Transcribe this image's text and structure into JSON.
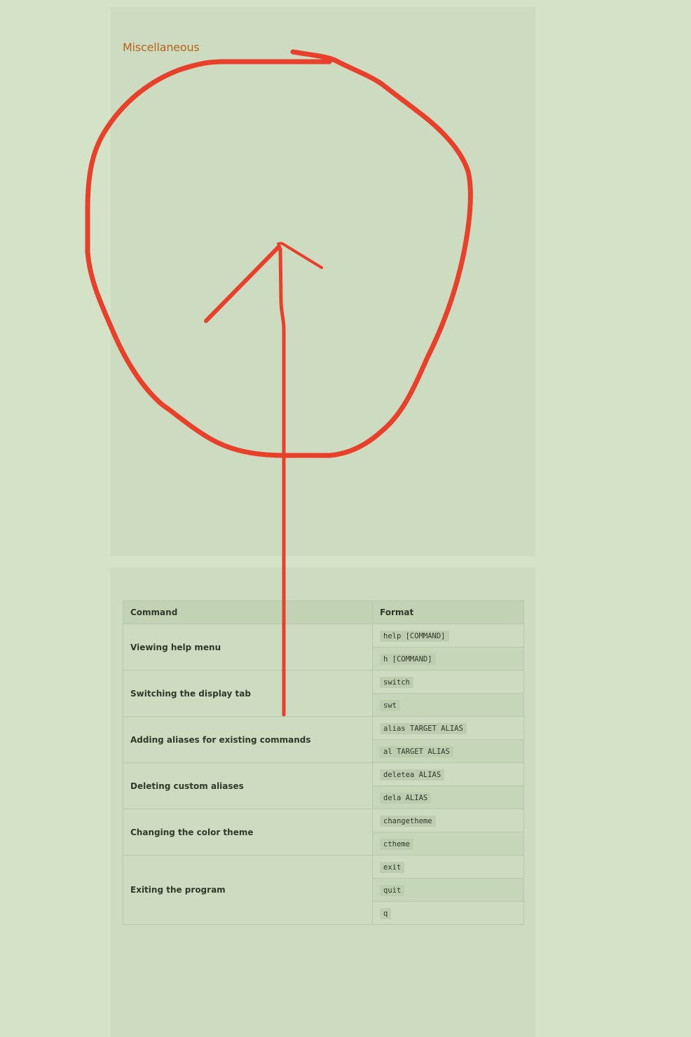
{
  "section": {
    "title": "Miscellaneous"
  },
  "table": {
    "headers": {
      "command": "Command",
      "format": "Format"
    },
    "rows": [
      {
        "command": "Viewing help menu",
        "formats": [
          "help [COMMAND]",
          "h [COMMAND]"
        ]
      },
      {
        "command": "Switching the display tab",
        "formats": [
          "switch",
          "swt"
        ]
      },
      {
        "command": "Adding aliases for existing commands",
        "formats": [
          "alias TARGET ALIAS",
          "al TARGET ALIAS"
        ]
      },
      {
        "command": "Deleting custom aliases",
        "formats": [
          "deletea ALIAS",
          "dela ALIAS"
        ]
      },
      {
        "command": "Changing the color theme",
        "formats": [
          "changetheme",
          "ctheme"
        ]
      },
      {
        "command": "Exiting the program",
        "formats": [
          "exit",
          "quit",
          "q"
        ]
      }
    ]
  },
  "annotation": {
    "color": "#e8402a"
  }
}
